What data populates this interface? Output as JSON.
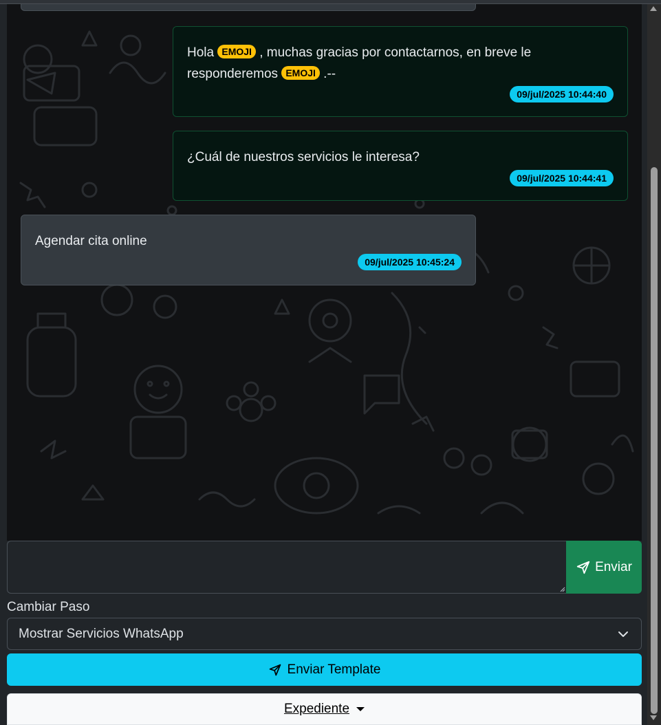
{
  "chat": {
    "messages": [
      {
        "direction": "outgoing",
        "text_before": "Hola",
        "tag1": "EMOJI",
        "text_middle": ", muchas gracias por contactarnos, en breve le responderemos",
        "tag2": "EMOJI",
        "text_after": ".--",
        "timestamp": "09/jul/2025 10:44:40"
      },
      {
        "direction": "outgoing",
        "text": "¿Cuál de nuestros servicios le interesa?",
        "timestamp": "09/jul/2025 10:44:41"
      },
      {
        "direction": "incoming",
        "text": "Agendar cita online",
        "timestamp": "09/jul/2025 10:45:24"
      }
    ]
  },
  "composer": {
    "message_value": "",
    "send_label": "Enviar",
    "send_icon": "send-icon"
  },
  "step": {
    "label": "Cambiar Paso",
    "selected": "Mostrar Servicios WhatsApp"
  },
  "template_button": {
    "label": "Enviar Template",
    "icon": "send-icon"
  },
  "expediente_button": {
    "label": "Expediente"
  },
  "colors": {
    "outgoing_bg": "#051611",
    "incoming_bg": "#343a40",
    "timestamp_badge": "#0dcaf0",
    "tag_badge": "#ffc107",
    "send_button": "#198754",
    "template_button": "#0dcaf0"
  }
}
